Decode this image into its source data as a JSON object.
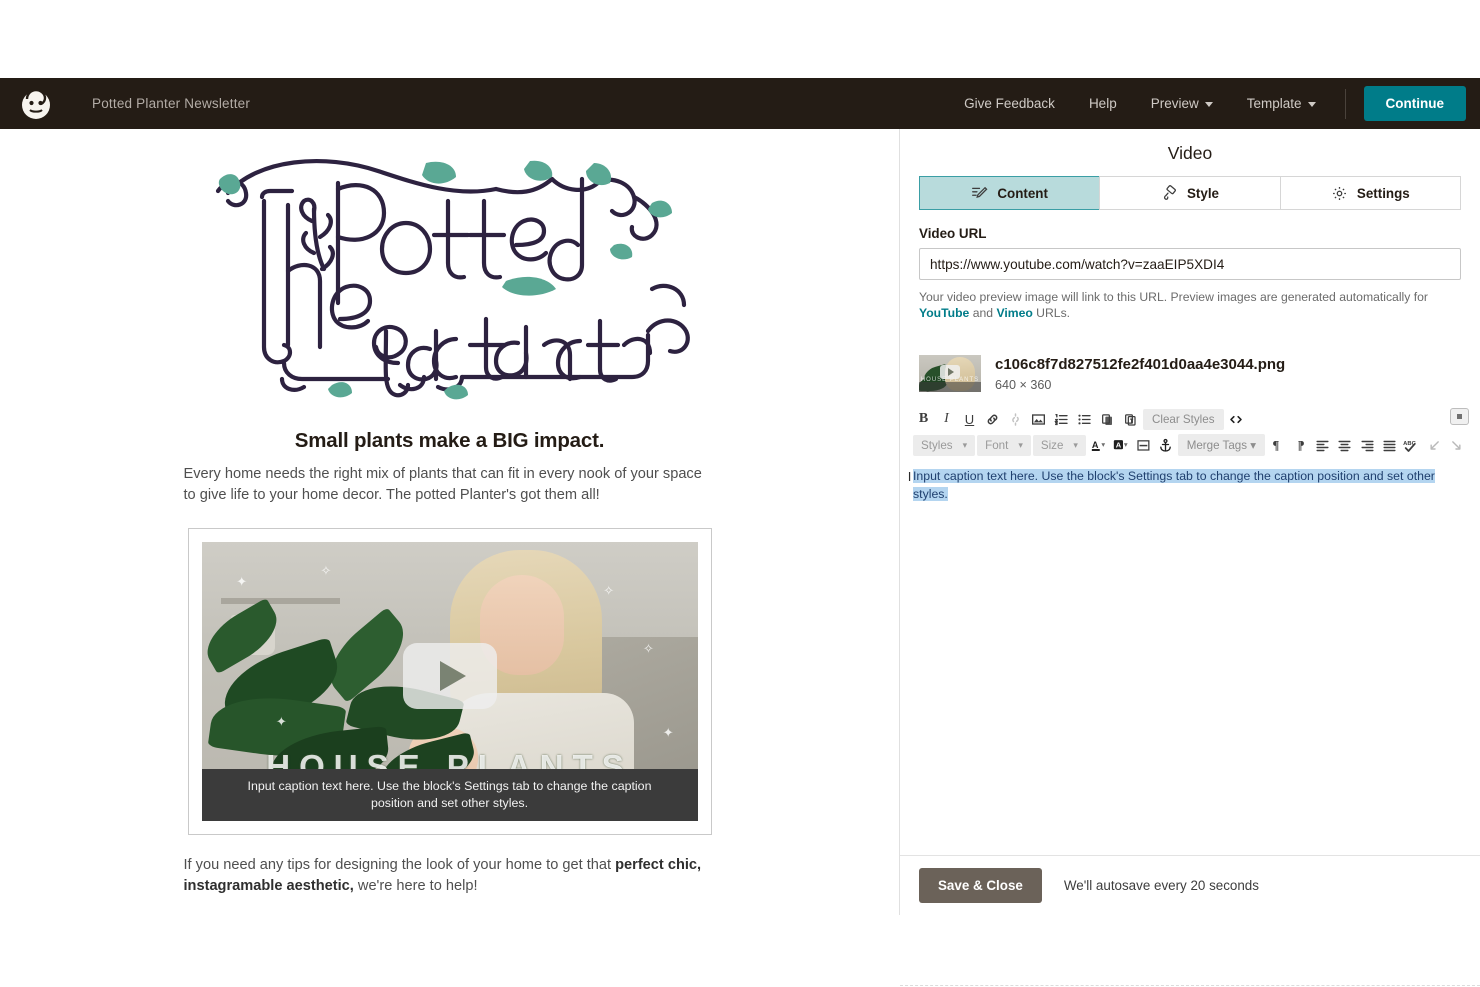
{
  "header": {
    "logo_icon": "mailchimp-monkey-logo",
    "campaign_title": "Potted Planter Newsletter",
    "nav": [
      {
        "label": "Give Feedback",
        "has_caret": false
      },
      {
        "label": "Help",
        "has_caret": false
      },
      {
        "label": "Preview",
        "has_caret": true
      },
      {
        "label": "Template",
        "has_caret": true
      }
    ],
    "continue_label": "Continue",
    "continue_color": "#007c89"
  },
  "email_preview": {
    "logo_alt": "The Potted Planter",
    "logo_colors": {
      "ink": "#2d2240",
      "accent": "#5aa894"
    },
    "headline": "Small plants make a BIG impact.",
    "paragraph": "Every home needs the right mix of plants that can fit in every nook of your space to give life to your home decor. The potted Planter's got them all!",
    "video": {
      "overlay_title": "HOUSE PLANTS",
      "caption": "Input caption text here. Use the block's Settings tab to change the caption position and set other styles.",
      "play_icon": "play-button-icon"
    },
    "footer_paragraph_lead": "If you need any tips for designing the look of your home to get that ",
    "footer_paragraph_bold": "perfect chic, instagramable aesthetic,",
    "footer_paragraph_tail": " we're here to help!"
  },
  "panel": {
    "title": "Video",
    "tabs": [
      {
        "label": "Content",
        "icon": "content-pencil-icon",
        "active": true
      },
      {
        "label": "Style",
        "icon": "style-brush-icon",
        "active": false
      },
      {
        "label": "Settings",
        "icon": "gear-icon",
        "active": false
      }
    ],
    "active_tab_color": "#b8dbdc",
    "video_url_label": "Video URL",
    "video_url_value": "https://www.youtube.com/watch?v=zaaEIP5XDI4",
    "helper_lead": "Your video preview image will link to this URL. Preview images are generated automatically for ",
    "helper_link_1": "YouTube",
    "helper_mid": " and ",
    "helper_link_2": "Vimeo",
    "helper_tail": " URLs.",
    "helper_link_color": "#007c89",
    "file": {
      "name": "c106c8f7d827512fe2f401d0aa4e3044.png",
      "dimensions": "640 × 360",
      "thumb_label": "HOUSE PLANTS"
    },
    "toolbar_row1": [
      {
        "name": "bold-icon",
        "glyph": "B",
        "disabled": false
      },
      {
        "name": "italic-icon",
        "glyph": "I",
        "disabled": false
      },
      {
        "name": "underline-icon",
        "glyph": "U",
        "disabled": false
      },
      {
        "name": "link-icon",
        "glyph": "link",
        "disabled": false
      },
      {
        "name": "unlink-icon",
        "glyph": "unlink",
        "disabled": true
      },
      {
        "name": "image-icon",
        "glyph": "image",
        "disabled": false
      },
      {
        "name": "numbered-list-icon",
        "glyph": "ol",
        "disabled": false
      },
      {
        "name": "bullet-list-icon",
        "glyph": "ul",
        "disabled": false
      },
      {
        "name": "paste-icon",
        "glyph": "paste",
        "disabled": false
      },
      {
        "name": "paste-as-text-icon",
        "glyph": "paste-text",
        "disabled": false
      }
    ],
    "clear_styles_label": "Clear Styles",
    "code_view_icon": "code-brackets-icon",
    "toolbar_row2_selects": [
      {
        "label": "Styles",
        "name": "styles-select"
      },
      {
        "label": "Font",
        "name": "font-select"
      },
      {
        "label": "Size",
        "name": "size-select"
      }
    ],
    "merge_tags_label": "Merge Tags",
    "toolbar_row2_icons": [
      {
        "name": "text-color-icon",
        "glyph": "A"
      },
      {
        "name": "background-color-icon",
        "glyph": "A-bg"
      },
      {
        "name": "horizontal-rule-icon",
        "glyph": "hr"
      },
      {
        "name": "anchor-icon",
        "glyph": "anchor"
      },
      {
        "name": "paragraph-ltr-icon",
        "glyph": "pilcrow"
      },
      {
        "name": "paragraph-rtl-icon",
        "glyph": "pilcrow-rtl"
      },
      {
        "name": "align-left-icon",
        "glyph": "align-left"
      },
      {
        "name": "align-center-icon",
        "glyph": "align-center"
      },
      {
        "name": "align-right-icon",
        "glyph": "align-right"
      },
      {
        "name": "align-justify-icon",
        "glyph": "align-justify"
      },
      {
        "name": "spellcheck-icon",
        "glyph": "abc-check"
      },
      {
        "name": "undo-icon",
        "glyph": "undo"
      },
      {
        "name": "redo-icon",
        "glyph": "redo"
      }
    ],
    "collapse_icon": "collapse-toolbar-icon",
    "caption_text": "Input caption text here. Use the block's Settings tab to change the caption position and set other styles.",
    "caption_selected": true,
    "caption_selection_color": "#b4d5f0",
    "save_label": "Save & Close",
    "autosave_text": "We'll autosave every 20 seconds"
  }
}
